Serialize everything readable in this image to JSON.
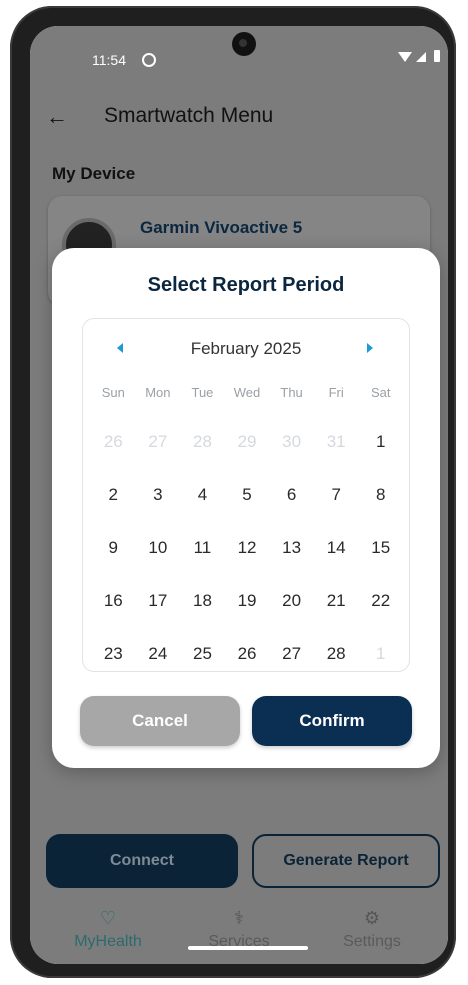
{
  "status_bar": {
    "time": "11:54"
  },
  "app_bar": {
    "title": "Smartwatch Menu"
  },
  "section": {
    "title": "My Device"
  },
  "device": {
    "name": "Garmin Vivoactive 5"
  },
  "actions": {
    "connect_label": "Connect",
    "report_label": "Generate Report"
  },
  "nav": {
    "items": [
      {
        "label": "MyHealth",
        "icon": "heart-hand-icon",
        "active": true
      },
      {
        "label": "Services",
        "icon": "stethoscope-icon",
        "active": false
      },
      {
        "label": "Settings",
        "icon": "gear-icon",
        "active": false
      }
    ]
  },
  "dialog": {
    "title": "Select Report Period",
    "month_label": "February 2025",
    "weekdays": [
      "Sun",
      "Mon",
      "Tue",
      "Wed",
      "Thu",
      "Fri",
      "Sat"
    ],
    "weeks": [
      [
        "26",
        "27",
        "28",
        "29",
        "30",
        "31",
        "1"
      ],
      [
        "2",
        "3",
        "4",
        "5",
        "6",
        "7",
        "8"
      ],
      [
        "9",
        "10",
        "11",
        "12",
        "13",
        "14",
        "15"
      ],
      [
        "16",
        "17",
        "18",
        "19",
        "20",
        "21",
        "22"
      ],
      [
        "23",
        "24",
        "25",
        "26",
        "27",
        "28",
        "1"
      ]
    ],
    "muted": [
      [
        true,
        true,
        true,
        true,
        true,
        true,
        false
      ],
      [
        false,
        false,
        false,
        false,
        false,
        false,
        false
      ],
      [
        false,
        false,
        false,
        false,
        false,
        false,
        false
      ],
      [
        false,
        false,
        false,
        false,
        false,
        false,
        false
      ],
      [
        false,
        false,
        false,
        false,
        false,
        false,
        true
      ]
    ],
    "cancel_label": "Cancel",
    "confirm_label": "Confirm"
  },
  "colors": {
    "accent": "#1e9bd7",
    "primary": "#0b2f53",
    "scrim": "#7c7c7c"
  }
}
